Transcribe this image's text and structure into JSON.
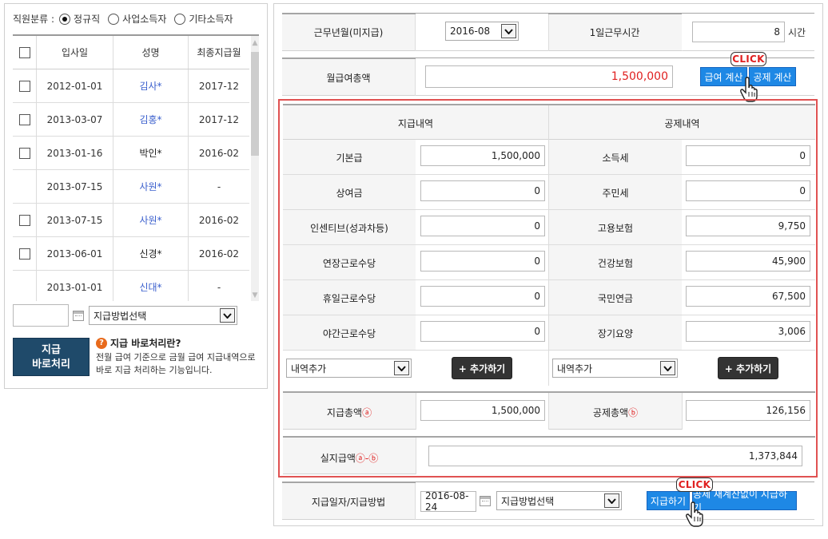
{
  "filter": {
    "label": "직원분류 :",
    "options": [
      {
        "label": "정규직",
        "selected": true
      },
      {
        "label": "사업소득자",
        "selected": false
      },
      {
        "label": "기타소득자",
        "selected": false
      }
    ]
  },
  "employees": {
    "headers": [
      "입사일",
      "성명",
      "최종지급월"
    ],
    "rows": [
      {
        "checkbox": true,
        "date": "2012-01-01",
        "name": "김사*",
        "link": true,
        "last": "2017-12"
      },
      {
        "checkbox": true,
        "date": "2013-03-07",
        "name": "김홍*",
        "link": true,
        "last": "2017-12"
      },
      {
        "checkbox": true,
        "date": "2013-01-16",
        "name": "박인*",
        "link": false,
        "last": "2016-02"
      },
      {
        "checkbox": false,
        "date": "2013-07-15",
        "name": "사원*",
        "link": true,
        "last": "-"
      },
      {
        "checkbox": true,
        "date": "2013-07-15",
        "name": "사원*",
        "link": true,
        "last": "2016-02"
      },
      {
        "checkbox": true,
        "date": "2013-06-01",
        "name": "신경*",
        "link": false,
        "last": "2016-02"
      },
      {
        "checkbox": false,
        "date": "2013-01-01",
        "name": "신대*",
        "link": true,
        "last": "-"
      }
    ]
  },
  "left_bottom": {
    "date_value": "",
    "method_select": "지급방법선택",
    "pay_button": [
      "지급",
      "바로처리"
    ],
    "help_title": "지급 바로처리란?",
    "help_desc": "전월 급여 기준으로 금월 급여 지급내역으로 바로 지급 처리하는 기능입니다."
  },
  "top": {
    "work_month_label": "근무년월(미지급)",
    "work_month_value": "2016-08",
    "daily_hours_label": "1일근무시간",
    "daily_hours_value": "8",
    "hours_unit": "시간",
    "monthly_total_label": "월급여총액",
    "monthly_total_value": "1,500,000",
    "calc_salary_button": "급여 계산",
    "calc_deduct_button": "공제 계산",
    "click_label": "CLICK"
  },
  "breakdown": {
    "pay_header": "지급내역",
    "deduct_header": "공제내역",
    "rows": [
      {
        "pay_label": "기본급",
        "pay_value": "1,500,000",
        "deduct_label": "소득세",
        "deduct_value": "0"
      },
      {
        "pay_label": "상여금",
        "pay_value": "0",
        "deduct_label": "주민세",
        "deduct_value": "0"
      },
      {
        "pay_label": "인센티브(성과차등)",
        "pay_value": "0",
        "deduct_label": "고용보험",
        "deduct_value": "9,750"
      },
      {
        "pay_label": "연장근로수당",
        "pay_value": "0",
        "deduct_label": "건강보험",
        "deduct_value": "45,900"
      },
      {
        "pay_label": "휴일근로수당",
        "pay_value": "0",
        "deduct_label": "국민연금",
        "deduct_value": "67,500"
      },
      {
        "pay_label": "야간근로수당",
        "pay_value": "0",
        "deduct_label": "장기요양",
        "deduct_value": "3,006"
      }
    ],
    "add_item_select": "내역추가",
    "add_button": "+ 추가하기",
    "pay_total_label": "지급총액",
    "pay_total_mark": "ⓐ",
    "pay_total_value": "1,500,000",
    "deduct_total_label": "공제총액",
    "deduct_total_mark": "ⓑ",
    "deduct_total_value": "126,156",
    "net_label": "실지급액",
    "net_mark": "ⓐ-ⓑ",
    "net_value": "1,373,844"
  },
  "payment": {
    "label": "지급일자/지급방법",
    "date_value": "2016-08-24",
    "method_select": "지급방법선택",
    "pay_button": "지급하기",
    "pay_without_recalc_button": "공제 재계산없이 지급하기",
    "click_label": "CLICK"
  },
  "icons": {
    "calendar": "calendar-icon",
    "dropdown": "chevron-down-icon",
    "hand": "hand-pointer-icon",
    "help": "question-icon"
  }
}
